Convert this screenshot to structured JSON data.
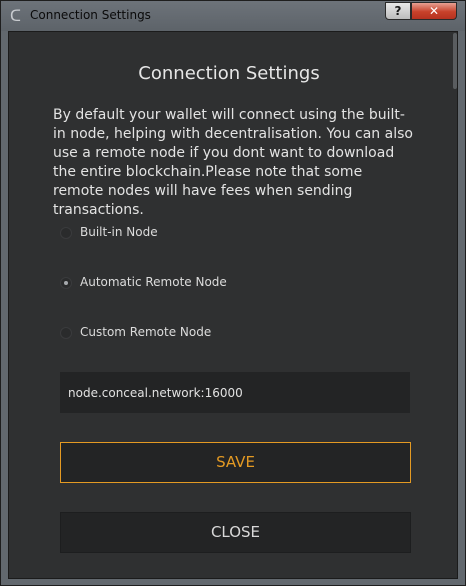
{
  "window": {
    "title": "Connection Settings",
    "help_glyph": "?",
    "close_glyph": "✕"
  },
  "dialog": {
    "heading": "Connection Settings",
    "description": "By default your wallet will connect using the built-in node, helping with decentralisation. You can also use a remote node if you dont want to download the entire blockchain.Please note that some remote nodes will have fees when sending transactions.",
    "options": [
      {
        "label": "Built-in Node",
        "selected": false
      },
      {
        "label": "Automatic Remote Node",
        "selected": true
      },
      {
        "label": "Custom Remote Node",
        "selected": false
      }
    ],
    "node_address": "node.conceal.network:16000",
    "save_label": "SAVE",
    "close_label": "CLOSE"
  },
  "icons": {
    "app": "app-icon",
    "help": "help-icon",
    "close": "close-icon"
  },
  "colors": {
    "accent": "#e49a23",
    "panel": "#2f3031",
    "field": "#232425",
    "window_frame": "#62686e",
    "close_button": "#c7412a"
  }
}
